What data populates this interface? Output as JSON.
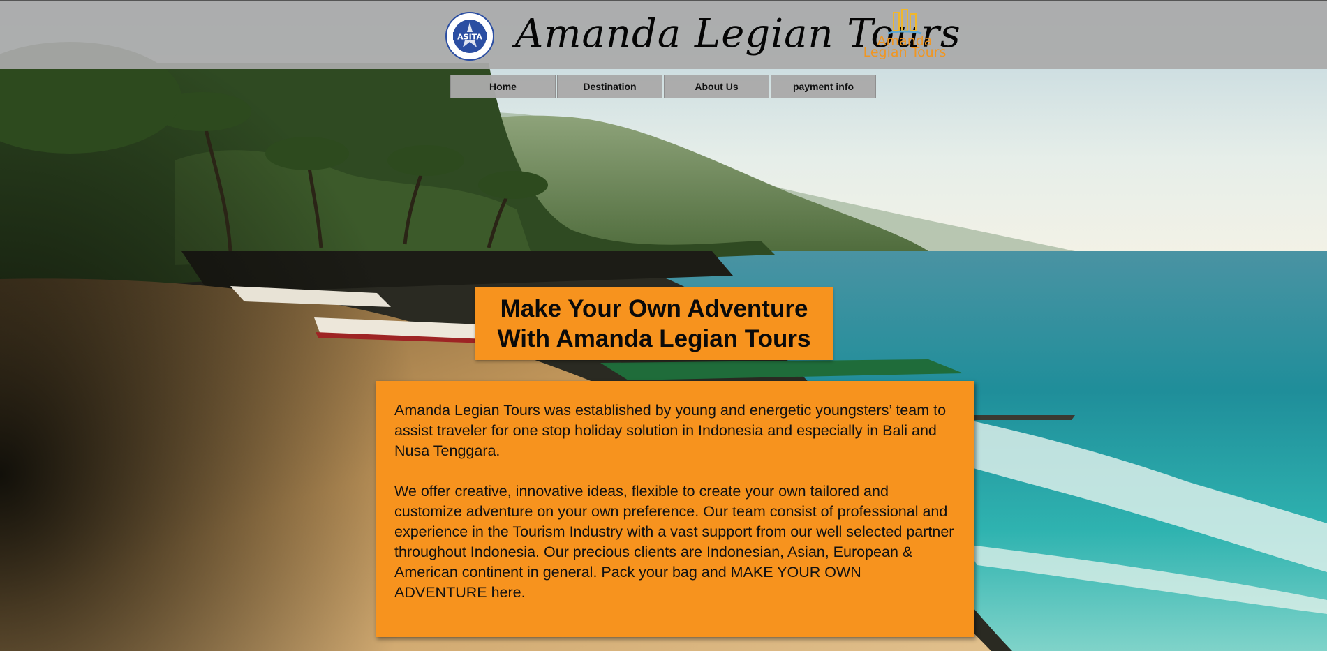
{
  "header": {
    "brand_title": "Amanda Legian Tours",
    "asita_logo_text": "ASITA",
    "logo_right_line1": "Amanda",
    "logo_right_line2": "Legian Tours"
  },
  "nav": {
    "items": [
      {
        "label": "Home"
      },
      {
        "label": "Destination"
      },
      {
        "label": "About Us"
      },
      {
        "label": "payment info"
      }
    ]
  },
  "hero": {
    "headline_line1": "Make Your Own Adventure",
    "headline_line2": "With Amanda Legian Tours"
  },
  "intro": {
    "paragraph1": "Amanda Legian Tours was established by young and energetic youngsters’ team to assist traveler for one stop holiday solution in Indonesia and especially in Bali and Nusa Tenggara.",
    "paragraph2": "We offer creative, innovative ideas, flexible to create your own tailored and customize adventure on your own preference. Our team consist of professional and experience in the Tourism Industry with a vast support from our well selected partner throughout Indonesia. Our precious clients are Indonesian, Asian, European & American continent in general. Pack your bag and MAKE YOUR OWN ADVENTURE here."
  },
  "colors": {
    "accent_orange": "#f7931e",
    "header_gray": "#aaaaaa",
    "logo_orange": "#f09622",
    "asita_blue": "#2b4ea2"
  },
  "icons": [
    "asita-logo-icon",
    "amanda-legian-logo-icon"
  ]
}
